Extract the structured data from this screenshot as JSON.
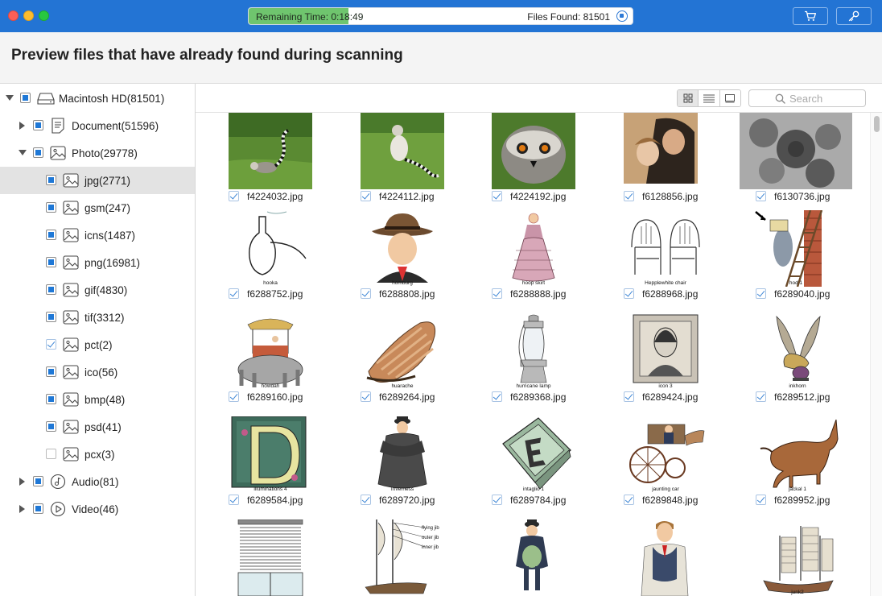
{
  "titlebar": {
    "remaining_label": "Remaining Time: 0:18:49",
    "files_found_label": "Files Found: 81501",
    "progress": 0.26
  },
  "header": {
    "title": "Preview files that have already found during scanning"
  },
  "sidebar": {
    "items": [
      {
        "label": "Macintosh HD(81501)"
      },
      {
        "label": "Document(51596)"
      },
      {
        "label": "Photo(29778)"
      },
      {
        "label": "jpg(2771)"
      },
      {
        "label": "gsm(247)"
      },
      {
        "label": "icns(1487)"
      },
      {
        "label": "png(16981)"
      },
      {
        "label": "gif(4830)"
      },
      {
        "label": "tif(3312)"
      },
      {
        "label": "pct(2)"
      },
      {
        "label": "ico(56)"
      },
      {
        "label": "bmp(48)"
      },
      {
        "label": "psd(41)"
      },
      {
        "label": "pcx(3)"
      },
      {
        "label": "Audio(81)"
      },
      {
        "label": "Video(46)"
      }
    ]
  },
  "toolbar": {
    "search_placeholder": "Search"
  },
  "files": [
    {
      "name": "f4224032.jpg"
    },
    {
      "name": "f4224112.jpg"
    },
    {
      "name": "f4224192.jpg"
    },
    {
      "name": "f6128856.jpg"
    },
    {
      "name": "f6130736.jpg"
    },
    {
      "name": "f6288752.jpg",
      "caption": "hooka"
    },
    {
      "name": "f6288808.jpg",
      "caption": "homburg"
    },
    {
      "name": "f6288888.jpg",
      "caption": "hoop skirt"
    },
    {
      "name": "f6288968.jpg",
      "caption": "Hepplewhite chair"
    },
    {
      "name": "f6289040.jpg",
      "caption": "hod 1"
    },
    {
      "name": "f6289160.jpg",
      "caption": "howdah"
    },
    {
      "name": "f6289264.jpg",
      "caption": "huarache"
    },
    {
      "name": "f6289368.jpg",
      "caption": "hurricane lamp"
    },
    {
      "name": "f6289424.jpg",
      "caption": "icon 3"
    },
    {
      "name": "f6289512.jpg",
      "caption": "inkhorn"
    },
    {
      "name": "f6289584.jpg",
      "caption": "illuminations 4"
    },
    {
      "name": "f6289720.jpg",
      "caption": "Inverness"
    },
    {
      "name": "f6289784.jpg",
      "caption": "intaglio 1"
    },
    {
      "name": "f6289848.jpg",
      "caption": "jaunting car"
    },
    {
      "name": "f6289952.jpg",
      "caption": "jackal 1"
    },
    {
      "name": ""
    },
    {
      "name": "",
      "labels": [
        "flying jib",
        "outer jib",
        "inner jib"
      ]
    },
    {
      "name": ""
    },
    {
      "name": ""
    },
    {
      "name": "",
      "caption": "junk2"
    }
  ]
}
